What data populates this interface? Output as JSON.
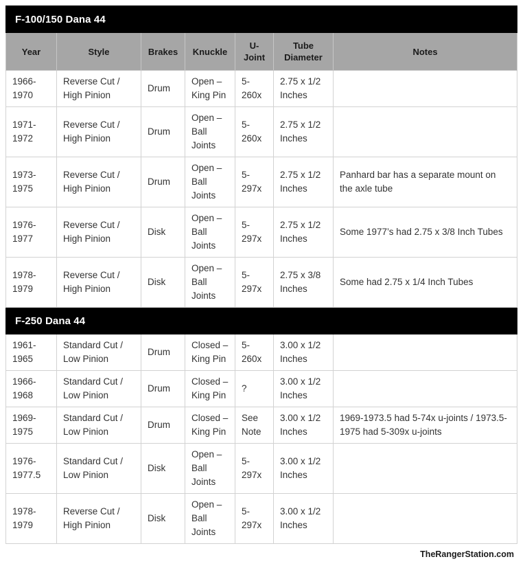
{
  "table": {
    "columns": [
      {
        "key": "year",
        "label": "Year"
      },
      {
        "key": "style",
        "label": "Style"
      },
      {
        "key": "brakes",
        "label": "Brakes"
      },
      {
        "key": "knuckle",
        "label": "Knuckle"
      },
      {
        "key": "ujoint",
        "label": "U-\nJoint"
      },
      {
        "key": "tube",
        "label": "Tube\nDiameter"
      },
      {
        "key": "notes",
        "label": "Notes"
      }
    ],
    "sections": [
      {
        "title": "F-100/150 Dana 44",
        "rows": [
          {
            "year": "1966-\n1970",
            "style": "Reverse Cut /\nHigh Pinion",
            "brakes": "Drum",
            "knuckle": "Open –\nKing Pin",
            "ujoint": "5-\n260x",
            "tube": "2.75 x 1/2\nInches",
            "notes": ""
          },
          {
            "year": "1971-\n1972",
            "style": "Reverse Cut /\nHigh Pinion",
            "brakes": "Drum",
            "knuckle": "Open –\nBall\nJoints",
            "ujoint": "5-\n260x",
            "tube": "2.75 x 1/2\nInches",
            "notes": ""
          },
          {
            "year": "1973-\n1975",
            "style": "Reverse Cut /\nHigh Pinion",
            "brakes": "Drum",
            "knuckle": "Open –\nBall\nJoints",
            "ujoint": "5-\n297x",
            "tube": "2.75 x 1/2\nInches",
            "notes": "Panhard bar has a separate mount on the axle tube"
          },
          {
            "year": "1976-\n1977",
            "style": "Reverse Cut /\nHigh Pinion",
            "brakes": "Disk",
            "knuckle": "Open –\nBall\nJoints",
            "ujoint": "5-\n297x",
            "tube": "2.75 x 1/2\nInches",
            "notes": "Some 1977’s had 2.75 x 3/8 Inch Tubes"
          },
          {
            "year": "1978-\n1979",
            "style": "Reverse Cut /\nHigh Pinion",
            "brakes": "Disk",
            "knuckle": "Open –\nBall\nJoints",
            "ujoint": "5-\n297x",
            "tube": "2.75 x 3/8\nInches",
            "notes": "Some had 2.75 x 1/4 Inch Tubes"
          }
        ]
      },
      {
        "title": "F-250 Dana 44",
        "rows": [
          {
            "year": "1961-\n1965",
            "style": "Standard Cut /\nLow Pinion",
            "brakes": "Drum",
            "knuckle": "Closed –\nKing Pin",
            "ujoint": "5-\n260x",
            "tube": "3.00 x 1/2\nInches",
            "notes": ""
          },
          {
            "year": "1966-\n1968",
            "style": "Standard Cut /\nLow Pinion",
            "brakes": "Drum",
            "knuckle": "Closed –\nKing Pin",
            "ujoint": "?",
            "tube": "3.00 x 1/2\nInches",
            "notes": ""
          },
          {
            "year": "1969-\n1975",
            "style": "Standard Cut /\nLow Pinion",
            "brakes": "Drum",
            "knuckle": "Closed –\nKing Pin",
            "ujoint": "See\nNote",
            "tube": "3.00 x 1/2\nInches",
            "notes": "1969-1973.5 had 5-74x u-joints / 1973.5-1975 had 5-309x u-joints"
          },
          {
            "year": "1976-\n1977.5",
            "style": "Standard Cut /\nLow Pinion",
            "brakes": "Disk",
            "knuckle": "Open –\nBall\nJoints",
            "ujoint": "5-\n297x",
            "tube": "3.00 x 1/2\nInches",
            "notes": ""
          },
          {
            "year": "1978-\n1979",
            "style": "Reverse Cut /\nHigh Pinion",
            "brakes": "Disk",
            "knuckle": "Open –\nBall\nJoints",
            "ujoint": "5-\n297x",
            "tube": "3.00 x 1/2\nInches",
            "notes": ""
          }
        ]
      }
    ]
  },
  "footer": {
    "credit": "TheRangerStation.com"
  },
  "colors": {
    "section_banner_bg": "#000000",
    "section_banner_text": "#ffffff",
    "column_header_bg": "#a6a6a6",
    "cell_text": "#333333",
    "table_border": "#3a3a3a",
    "grid_line": "#d2d2d2",
    "page_bg": "#ffffff"
  }
}
